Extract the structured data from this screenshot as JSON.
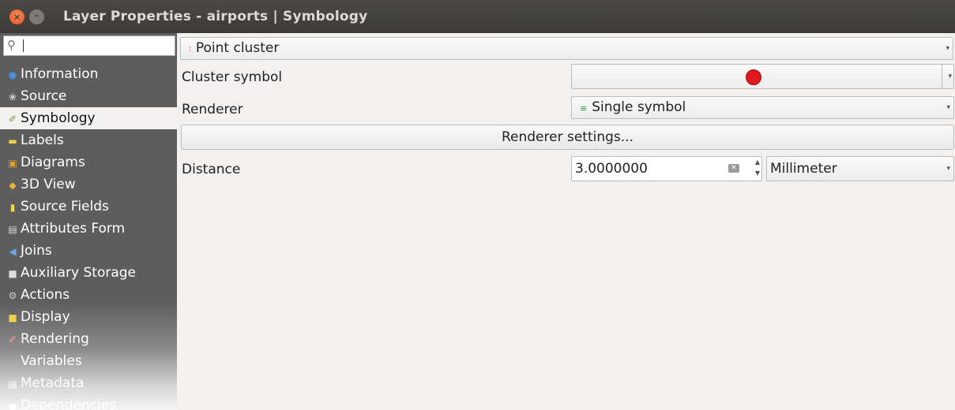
{
  "window": {
    "title": "Layer Properties - airports | Symbology",
    "close_glyph": "×",
    "minimize_glyph": "−"
  },
  "sidebar": {
    "search_placeholder": "",
    "items": [
      {
        "label": "Information",
        "icon": "info-icon"
      },
      {
        "label": "Source",
        "icon": "source-icon"
      },
      {
        "label": "Symbology",
        "icon": "symbology-icon",
        "selected": true
      },
      {
        "label": "Labels",
        "icon": "labels-icon"
      },
      {
        "label": "Diagrams",
        "icon": "diagrams-icon"
      },
      {
        "label": "3D View",
        "icon": "3d-view-icon"
      },
      {
        "label": "Source Fields",
        "icon": "source-fields-icon"
      },
      {
        "label": "Attributes Form",
        "icon": "attributes-form-icon"
      },
      {
        "label": "Joins",
        "icon": "joins-icon"
      },
      {
        "label": "Auxiliary Storage",
        "icon": "auxiliary-storage-icon"
      },
      {
        "label": "Actions",
        "icon": "actions-icon"
      },
      {
        "label": "Display",
        "icon": "display-icon"
      },
      {
        "label": "Rendering",
        "icon": "rendering-icon"
      },
      {
        "label": "Variables",
        "icon": "variables-icon"
      },
      {
        "label": "Metadata",
        "icon": "metadata-icon"
      },
      {
        "label": "Dependencies",
        "icon": "dependencies-icon"
      }
    ]
  },
  "main": {
    "renderer_type": "Point cluster",
    "cluster_symbol_label": "Cluster symbol",
    "cluster_symbol_color": "#e0191f",
    "renderer_label": "Renderer",
    "renderer_value": "Single symbol",
    "renderer_settings_button": "Renderer settings...",
    "distance_label": "Distance",
    "distance_value": "3.0000000",
    "distance_unit": "Millimeter"
  }
}
